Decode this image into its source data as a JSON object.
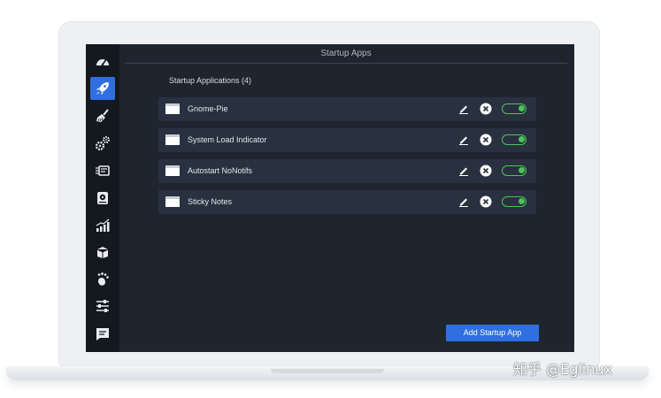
{
  "window": {
    "title": "Startup Apps"
  },
  "section": {
    "title": "Startup Applications (4)"
  },
  "sidebar": {
    "items": [
      {
        "icon": "dashboard-gauge-icon",
        "active": false
      },
      {
        "icon": "rocket-icon",
        "active": true
      },
      {
        "icon": "broom-icon",
        "active": false
      },
      {
        "icon": "gears-icon",
        "active": false
      },
      {
        "icon": "services-icon",
        "active": false
      },
      {
        "icon": "disk-icon",
        "active": false
      },
      {
        "icon": "resources-chart-icon",
        "active": false
      },
      {
        "icon": "packages-icon",
        "active": false
      },
      {
        "icon": "gnome-foot-icon",
        "active": false
      },
      {
        "icon": "settings-sliders-icon",
        "active": false
      },
      {
        "icon": "feedback-icon",
        "active": false
      }
    ]
  },
  "apps": [
    {
      "name": "Gnome-Pie",
      "enabled": true
    },
    {
      "name": "System Load Indicator",
      "enabled": true
    },
    {
      "name": "Autostart NoNotifs",
      "enabled": true
    },
    {
      "name": "Sticky Notes",
      "enabled": true
    }
  ],
  "actions": {
    "add_label": "Add Startup App"
  },
  "watermark": {
    "text": "知乎 @Eglinux"
  },
  "colors": {
    "accent": "#2f6fe0",
    "toggle_on": "#4cc257",
    "background": "#1f252f",
    "sidebar": "#141920",
    "row": "#293140"
  }
}
